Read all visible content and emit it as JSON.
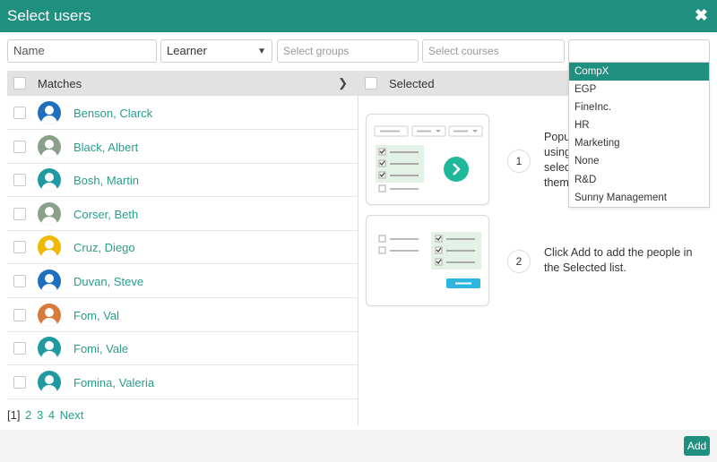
{
  "dialog": {
    "title": "Select users",
    "close_icon": "close-icon"
  },
  "filters": {
    "name_placeholder": "Name",
    "role_value": "Learner",
    "groups_placeholder": "Select groups",
    "courses_placeholder": "Select courses",
    "company_value": ""
  },
  "company_options": [
    "CompX",
    "EGP",
    "FineInc.",
    "HR",
    "Marketing",
    "None",
    "R&D",
    "Sunny Management"
  ],
  "company_selected_index": 0,
  "matches_header": "Matches",
  "selected_header": "Selected",
  "users": [
    {
      "name": "Benson, Clarck",
      "avatar_color": "#1f6fbf"
    },
    {
      "name": "Black, Albert",
      "avatar_color": "#8aa08a"
    },
    {
      "name": "Bosh, Martin",
      "avatar_color": "#1f9aa0"
    },
    {
      "name": "Corser, Beth",
      "avatar_color": "#8aa08a"
    },
    {
      "name": "Cruz, Diego",
      "avatar_color": "#f0b800"
    },
    {
      "name": "Duvan, Steve",
      "avatar_color": "#1f6fbf"
    },
    {
      "name": "Fom, Val",
      "avatar_color": "#d97a3a"
    },
    {
      "name": "Fomi, Vale",
      "avatar_color": "#1f9aa0"
    },
    {
      "name": "Fomina, Valeria",
      "avatar_color": "#1f9aa0"
    }
  ],
  "pagination": {
    "current": "[1]",
    "pages": [
      "2",
      "3",
      "4"
    ],
    "next": "Next"
  },
  "instructions": [
    {
      "num": "1",
      "lines": [
        "Popu",
        "using",
        "selec",
        "them"
      ]
    },
    {
      "num": "2",
      "lines": [
        "Click Add to add the people in",
        "the Selected list."
      ]
    }
  ],
  "add_label": "Add",
  "colors": {
    "accent": "#1f8f7f",
    "link": "#2a9d8a",
    "arrow": "#1fb89b",
    "button_blue": "#2bb5e0"
  }
}
